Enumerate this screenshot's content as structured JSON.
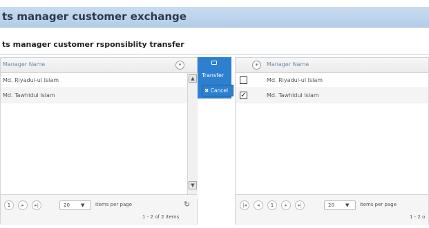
{
  "header": {
    "title": "ts manager customer exchange"
  },
  "section": {
    "title": "ts manager customer rsponsiblity transfer"
  },
  "left_grid": {
    "column": "Manager Name",
    "rows": [
      "Md. Riyadul-ul Islam",
      "Md. Tawhidul Islam"
    ],
    "pager": {
      "page": "1",
      "page_size": "20",
      "items_per_page": "items per page",
      "summary": "1 - 2 of 2 items"
    }
  },
  "actions": {
    "transfer": "Transfer",
    "cancel": "✖ Cancel"
  },
  "right_grid": {
    "column": "Manager Name",
    "rows": [
      {
        "name": "Md. Riyadul-ul Islam",
        "checked": false
      },
      {
        "name": "Md. Tawhidul Islam",
        "checked": true
      }
    ],
    "pager": {
      "page": "1",
      "page_size": "20",
      "items_per_page": "items per page",
      "summary": "1 - 2 o"
    }
  },
  "icons": {
    "filter": "filter-icon",
    "refresh": "refresh-icon",
    "transfer": "transfer-icon",
    "first": "first-page-icon",
    "prev": "prev-page-icon",
    "next": "next-page-icon",
    "last": "last-page-icon"
  },
  "colors": {
    "title_bar": "#c9dcf0",
    "action_panel": "#2d7fd0",
    "header_text": "#6a8bb0"
  }
}
